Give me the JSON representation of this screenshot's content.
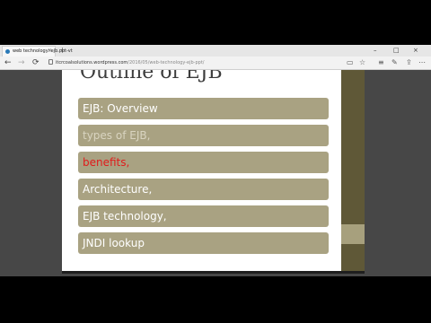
{
  "browser": {
    "tab_title": "web technology: ejb.ppt-vt",
    "tab_close": "×",
    "new_tab": "+",
    "window_controls": [
      "–",
      "□",
      "×"
    ],
    "nav": {
      "back": "←",
      "forward": "→",
      "refresh": "⟳"
    },
    "url_host": "itcrcoalsolutions.wordpress.com",
    "url_path": "/2016/05/web-technology-ejb-ppt/",
    "toolbar_icons": {
      "reading_view": "▭",
      "favorite": "☆",
      "hub": "≡",
      "notes": "✎",
      "share": "⇪",
      "more": "⋯"
    }
  },
  "slide": {
    "title": "Outline of EJB",
    "items": [
      {
        "text": "EJB: Overview",
        "color": "#ffffff"
      },
      {
        "text": "types of EJB,",
        "color": "#d9d4c0"
      },
      {
        "text": "benefits,",
        "color": "#e01b1b"
      },
      {
        "text": "Architecture,",
        "color": "#ffffff"
      },
      {
        "text": "EJB technology,",
        "color": "#ffffff"
      },
      {
        "text": "JNDI lookup",
        "color": "#ffffff"
      }
    ]
  },
  "colors": {
    "item_background": "#a9a282",
    "side_bar": "#5f5837",
    "side_accent": "#a7a07d"
  }
}
